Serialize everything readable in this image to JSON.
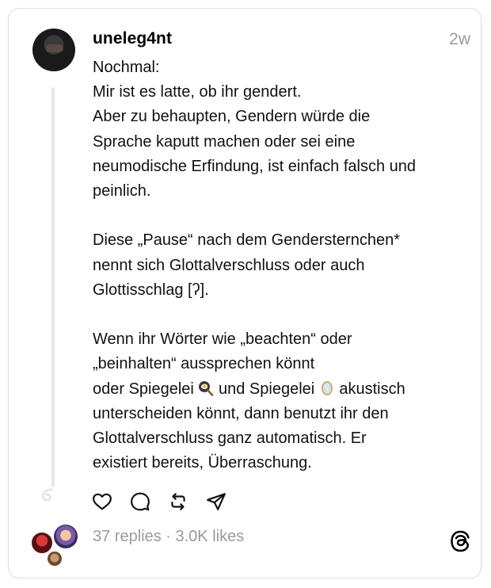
{
  "post": {
    "username": "uneleg4nt",
    "time": "2w",
    "lines_p1": [
      "Nochmal:",
      "Mir ist es latte, ob ihr gendert.",
      "Aber zu behaupten, Gendern würde die",
      "Sprache kaputt machen oder sei eine",
      "neumodische Erfindung, ist einfach falsch und",
      "peinlich."
    ],
    "lines_p2": [
      "Diese „Pause“ nach dem Gendersternchen*",
      "nennt sich Glottalverschluss oder auch",
      "Glottisschlag [ʔ]."
    ],
    "lines_p3": [
      "Wenn ihr Wörter wie „beachten“ oder",
      "„beinhalten“ aussprechen könnt"
    ],
    "spiegelei_line": {
      "part1": "oder Spiegelei",
      "part2": "und Spiegelei",
      "part3": "akustisch",
      "emoji1": "fried-egg-pan-icon",
      "emoji2": "mirror-icon"
    },
    "lines_p4": [
      "unterscheiden könnt, dann benutzt ihr den",
      "Glottalverschluss ganz automatisch. Er",
      "existiert bereits, Überraschung."
    ]
  },
  "actions": [
    "heart-icon",
    "comment-icon",
    "repost-icon",
    "share-icon"
  ],
  "stats": {
    "replies": "37 replies",
    "separator": "·",
    "likes": "3.0K likes",
    "full": "37 replies · 3.0K likes"
  },
  "colors": {
    "muted": "#9a9a9a",
    "border": "#dcdcdc",
    "thread_line": "#e6e6e6"
  }
}
